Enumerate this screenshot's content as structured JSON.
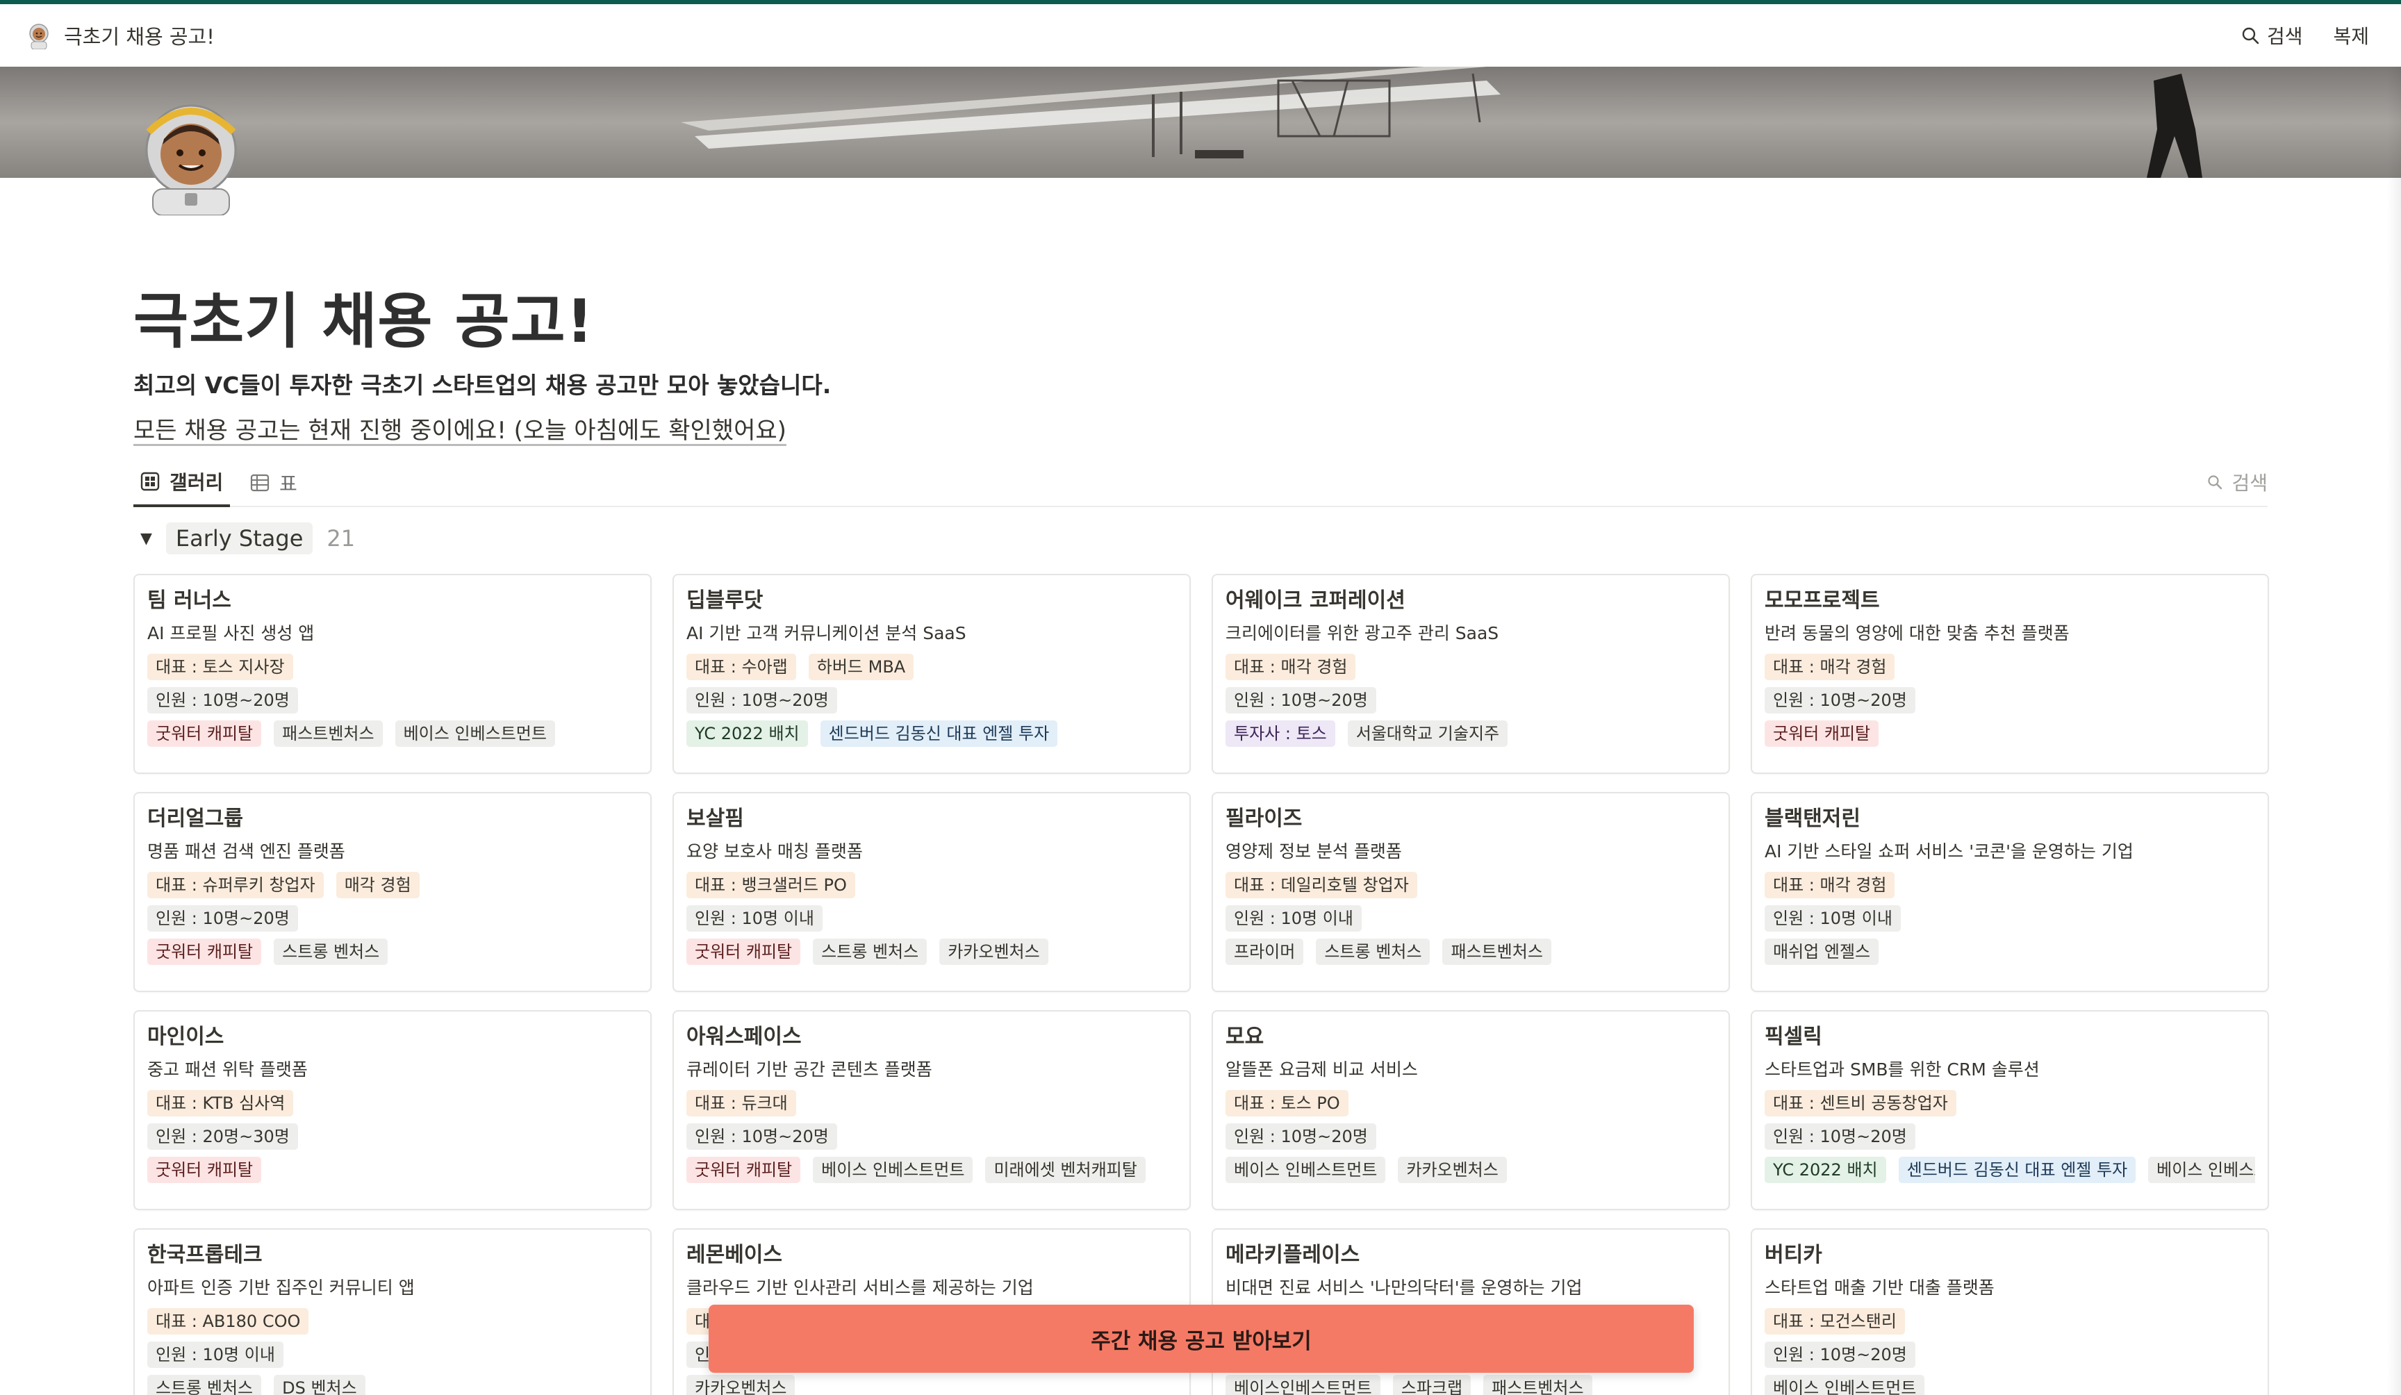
{
  "header": {
    "breadcrumb": "극초기 채용 공고!",
    "search_label": "검색",
    "duplicate_label": "복제"
  },
  "page": {
    "title": "극초기 채용 공고!",
    "subtitle": "최고의 VC들이 투자한 극초기 스타트업의 채용 공고만 모아 놓았습니다.",
    "note": "모든 채용 공고는 현재 진행 중이에요! (오늘 아침에도 확인했어요)"
  },
  "views": {
    "tabs": [
      {
        "label": "갤러리",
        "icon": "gallery-icon",
        "active": true
      },
      {
        "label": "표",
        "icon": "table-icon",
        "active": false
      }
    ],
    "search_label": "검색"
  },
  "group": {
    "label": "Early Stage",
    "count": "21"
  },
  "cards": [
    {
      "name": "팀 러너스",
      "desc": "AI 프로필 사진 생성 앱",
      "ceo": [
        {
          "text": "대표 : 토스 지사장",
          "color": "orange"
        }
      ],
      "size": "인원 : 10명~20명",
      "investors": [
        {
          "text": "굿워터 캐피탈",
          "color": "red"
        },
        {
          "text": "패스트벤처스",
          "color": "gray"
        },
        {
          "text": "베이스 인베스트먼트",
          "color": "gray"
        }
      ]
    },
    {
      "name": "딥블루닷",
      "desc": "AI 기반 고객 커뮤니케이션 분석 SaaS",
      "ceo": [
        {
          "text": "대표 : 수아랩",
          "color": "orange"
        },
        {
          "text": "하버드 MBA",
          "color": "orange"
        }
      ],
      "size": "인원 : 10명~20명",
      "investors": [
        {
          "text": "YC 2022 배치",
          "color": "green"
        },
        {
          "text": "센드버드 김동신 대표 엔젤 투자",
          "color": "blue"
        }
      ]
    },
    {
      "name": "어웨이크 코퍼레이션",
      "desc": "크리에이터를 위한 광고주 관리 SaaS",
      "ceo": [
        {
          "text": "대표 : 매각 경험",
          "color": "orange"
        }
      ],
      "size": "인원 : 10명~20명",
      "investors": [
        {
          "text": "투자사 : 토스",
          "color": "purple"
        },
        {
          "text": "서울대학교 기술지주",
          "color": "gray"
        }
      ]
    },
    {
      "name": "모모프로젝트",
      "desc": "반려 동물의 영양에 대한 맞춤 추천 플랫폼",
      "ceo": [
        {
          "text": "대표 : 매각 경험",
          "color": "orange"
        }
      ],
      "size": "인원 : 10명~20명",
      "investors": [
        {
          "text": "굿워터 캐피탈",
          "color": "red"
        }
      ]
    },
    {
      "name": "더리얼그룹",
      "desc": "명품 패션 검색 엔진 플랫폼",
      "ceo": [
        {
          "text": "대표 : 슈퍼루키 창업자",
          "color": "orange"
        },
        {
          "text": "매각 경험",
          "color": "orange"
        }
      ],
      "size": "인원 : 10명~20명",
      "investors": [
        {
          "text": "굿워터 캐피탈",
          "color": "red"
        },
        {
          "text": "스트롱 벤처스",
          "color": "gray"
        }
      ]
    },
    {
      "name": "보살핌",
      "desc": "요양 보호사 매칭 플랫폼",
      "ceo": [
        {
          "text": "대표 : 뱅크샐러드 PO",
          "color": "orange"
        }
      ],
      "size": "인원 : 10명 이내",
      "investors": [
        {
          "text": "굿워터 캐피탈",
          "color": "red"
        },
        {
          "text": "스트롱 벤처스",
          "color": "gray"
        },
        {
          "text": "카카오벤처스",
          "color": "gray"
        }
      ]
    },
    {
      "name": "필라이즈",
      "desc": "영양제 정보 분석 플랫폼",
      "ceo": [
        {
          "text": "대표 : 데일리호텔 창업자",
          "color": "orange"
        }
      ],
      "size": "인원 : 10명 이내",
      "investors": [
        {
          "text": "프라이머",
          "color": "gray"
        },
        {
          "text": "스트롱 벤처스",
          "color": "gray"
        },
        {
          "text": "패스트벤처스",
          "color": "gray"
        }
      ]
    },
    {
      "name": "블랙탠저린",
      "desc": "AI 기반 스타일 쇼퍼 서비스 '코콘'을 운영하는 기업",
      "ceo": [
        {
          "text": "대표 : 매각 경험",
          "color": "orange"
        }
      ],
      "size": "인원 : 10명 이내",
      "investors": [
        {
          "text": "매쉬업 엔젤스",
          "color": "gray"
        }
      ]
    },
    {
      "name": "마인이스",
      "desc": "중고 패션 위탁 플랫폼",
      "ceo": [
        {
          "text": "대표 : KTB 심사역",
          "color": "orange"
        }
      ],
      "size": "인원 : 20명~30명",
      "investors": [
        {
          "text": "굿워터 캐피탈",
          "color": "red"
        }
      ]
    },
    {
      "name": "아워스페이스",
      "desc": "큐레이터 기반 공간 콘텐츠 플랫폼",
      "ceo": [
        {
          "text": "대표 : 듀크대",
          "color": "orange"
        }
      ],
      "size": "인원 : 10명~20명",
      "investors": [
        {
          "text": "굿워터 캐피탈",
          "color": "red"
        },
        {
          "text": "베이스 인베스트먼트",
          "color": "gray"
        },
        {
          "text": "미래에셋 벤처캐피탈",
          "color": "gray"
        }
      ]
    },
    {
      "name": "모요",
      "desc": "알뜰폰 요금제 비교 서비스",
      "ceo": [
        {
          "text": "대표 : 토스 PO",
          "color": "orange"
        }
      ],
      "size": "인원 : 10명~20명",
      "investors": [
        {
          "text": "베이스 인베스트먼트",
          "color": "gray"
        },
        {
          "text": "카카오벤처스",
          "color": "gray"
        }
      ]
    },
    {
      "name": "픽셀릭",
      "desc": "스타트업과 SMB를 위한 CRM 솔루션",
      "ceo": [
        {
          "text": "대표 : 센트비 공동창업자",
          "color": "orange"
        }
      ],
      "size": "인원 : 10명~20명",
      "investors": [
        {
          "text": "YC 2022 배치",
          "color": "green"
        },
        {
          "text": "센드버드 김동신 대표 엔젤 투자",
          "color": "blue"
        },
        {
          "text": "베이스 인베스트먼트",
          "color": "gray"
        }
      ]
    },
    {
      "name": "한국프롭테크",
      "desc": "아파트 인증 기반 집주인 커뮤니티 앱",
      "ceo": [
        {
          "text": "대표 : AB180 COO",
          "color": "orange"
        }
      ],
      "size": "인원 : 10명 이내",
      "investors": [
        {
          "text": "스트롱 벤처스",
          "color": "gray"
        },
        {
          "text": "DS 벤처스",
          "color": "gray"
        }
      ]
    },
    {
      "name": "레몬베이스",
      "desc": "클라우드 기반 인사관리 서비스를 제공하는 기업",
      "ceo": [
        {
          "text": "대표",
          "color": "orange"
        }
      ],
      "size": "인원",
      "investors": [
        {
          "text": "카카오벤처스",
          "color": "gray"
        }
      ]
    },
    {
      "name": "메라키플레이스",
      "desc": "비대면 진료 서비스 '나만의닥터'를 운영하는 기업",
      "ceo": [],
      "size": "",
      "investors": [
        {
          "text": "베이스인베스트먼트",
          "color": "gray"
        },
        {
          "text": "스파크랩",
          "color": "gray"
        },
        {
          "text": "패스트벤처스",
          "color": "gray"
        }
      ]
    },
    {
      "name": "버티카",
      "desc": "스타트업 매출 기반 대출 플랫폼",
      "ceo": [
        {
          "text": "대표 : 모건스탠리",
          "color": "orange"
        }
      ],
      "size": "인원 : 10명~20명",
      "investors": [
        {
          "text": "베이스 인베스트먼트",
          "color": "gray"
        }
      ]
    }
  ],
  "cta": {
    "label": "주간 채용 공고 받아보기"
  },
  "colors": {
    "accent": "#0e5c4f",
    "cta": "#f57a65"
  }
}
